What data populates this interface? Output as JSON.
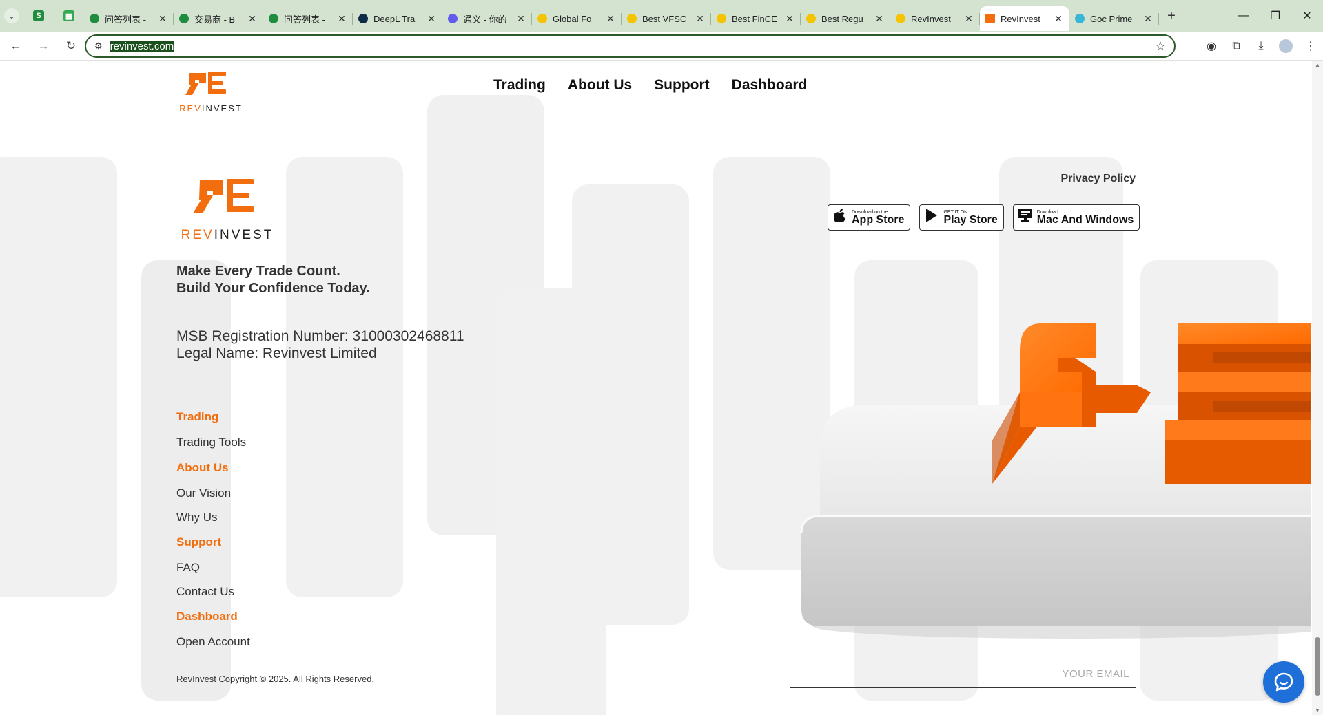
{
  "browser": {
    "tabs": [
      {
        "title": "问答列表 -",
        "favicon_color": "#1e8e3e"
      },
      {
        "title": "交易商 - B",
        "favicon_color": "#1e8e3e"
      },
      {
        "title": "问答列表 -",
        "favicon_color": "#1e8e3e"
      },
      {
        "title": "DeepL Tra",
        "favicon_color": "#0f2b46"
      },
      {
        "title": "通义 - 你的",
        "favicon_color": "#615ced"
      },
      {
        "title": "Global Fo",
        "favicon_color": "#f5c400"
      },
      {
        "title": "Best VFSC",
        "favicon_color": "#f5c400"
      },
      {
        "title": "Best FinCE",
        "favicon_color": "#f5c400"
      },
      {
        "title": "Best Regu",
        "favicon_color": "#f5c400"
      },
      {
        "title": "RevInvest",
        "favicon_color": "#f5c400"
      },
      {
        "title": "RevInvest",
        "favicon_color": "#f26d0e",
        "active": true
      },
      {
        "title": "Goc Prime",
        "favicon_color": "#38b6d8"
      }
    ],
    "url": "revinvest.com"
  },
  "brand": {
    "name_rev": "REV",
    "name_invest": "INVEST",
    "accent": "#f26d0e"
  },
  "nav": {
    "items": [
      "Trading",
      "About Us",
      "Support",
      "Dashboard"
    ]
  },
  "footer": {
    "tagline_line1": "Make Every Trade Count.",
    "tagline_line2": "Build Your Confidence Today.",
    "registration": "MSB Registration Number: 31000302468811",
    "legal_name": "Legal Name: Revinvest Limited",
    "groups": [
      {
        "head": "Trading",
        "items": [
          "Trading Tools"
        ]
      },
      {
        "head": "About Us",
        "items": [
          "Our Vision",
          "Why Us"
        ]
      },
      {
        "head": "Support",
        "items": [
          "FAQ",
          "Contact Us"
        ]
      },
      {
        "head": "Dashboard",
        "items": [
          "Open Account"
        ]
      }
    ],
    "copyright": "RevInvest Copyright © 2025. All Rights Reserved.",
    "privacy": "Privacy Policy",
    "stores": [
      {
        "small": "Download on the",
        "big": "App Store",
        "icon": "apple-icon"
      },
      {
        "small": "GET IT ON",
        "big": "Play Store",
        "icon": "play-icon"
      },
      {
        "small": "Download",
        "big": "Mac And Windows",
        "icon": "monitor-icon"
      }
    ],
    "email_placeholder": "YOUR EMAIL"
  }
}
